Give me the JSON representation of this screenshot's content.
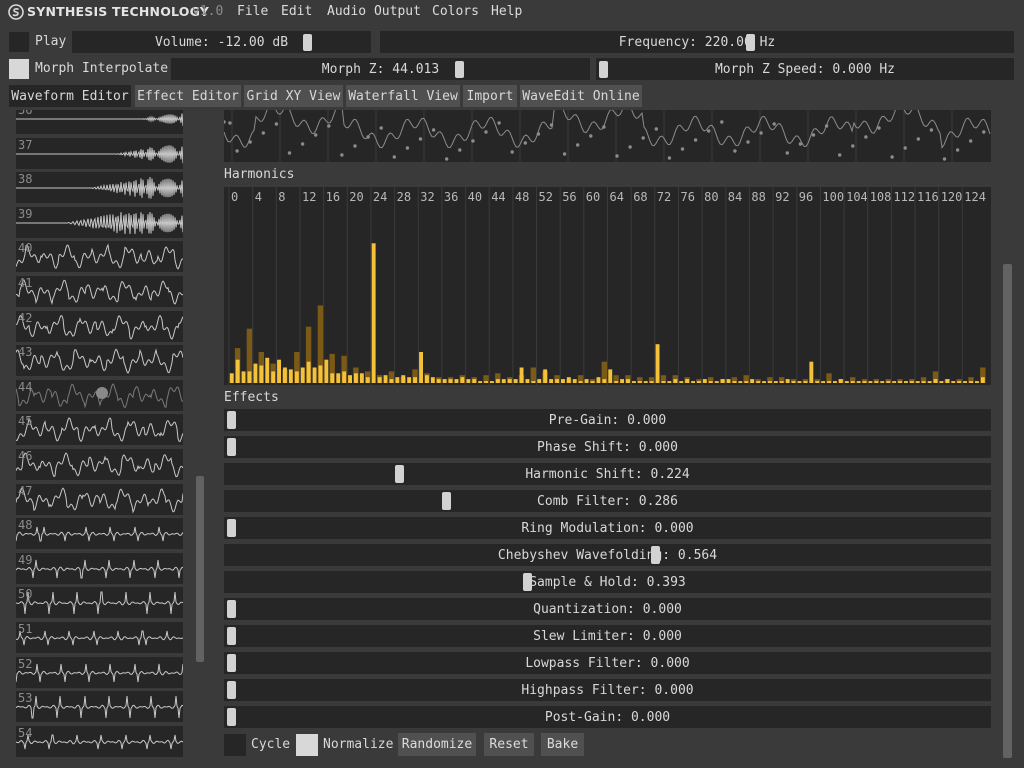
{
  "app": {
    "brand": "SYNTHESIS TECHNOLOGY",
    "version": "v1.0",
    "logo_icon": "synthesis-logo-icon"
  },
  "menu": [
    "File",
    "Edit",
    "Audio Output",
    "Colors",
    "Help"
  ],
  "controls": {
    "play_label": "Play",
    "volume_label": "Volume: -12.00 dB",
    "volume_value": "-12.00 dB",
    "frequency_label": "Frequency: 220.00 Hz",
    "frequency_value": "220.00 Hz",
    "morph_interpolate_label": "Morph Interpolate",
    "morph_z_label": "Morph Z: 44.013",
    "morph_z_value": "44.013",
    "morph_z_speed_label": "Morph Z Speed: 0.000 Hz",
    "morph_z_speed_value": "0.000 Hz"
  },
  "tabs": [
    "Waveform Editor",
    "Effect Editor",
    "Grid XY View",
    "Waterfall View",
    "Import",
    "WaveEdit Online"
  ],
  "active_tab": "Waveform Editor",
  "wave_list": [
    "36",
    "37",
    "38",
    "39",
    "40",
    "41",
    "42",
    "43",
    "44",
    "45",
    "46",
    "47",
    "48",
    "49",
    "50",
    "51",
    "52",
    "53",
    "54"
  ],
  "selected_wave": "44",
  "sections": {
    "harmonics": "Harmonics",
    "effects": "Effects"
  },
  "harmonic_labels": [
    "0",
    "4",
    "8",
    "12",
    "16",
    "20",
    "24",
    "28",
    "32",
    "36",
    "40",
    "44",
    "48",
    "52",
    "56",
    "60",
    "64",
    "68",
    "72",
    "76",
    "80",
    "84",
    "88",
    "92",
    "96",
    "100",
    "104",
    "108",
    "112",
    "116",
    "120",
    "124"
  ],
  "harmonics": {
    "max_index": 127,
    "light": [
      0.05,
      0.12,
      0.06,
      0.06,
      0.1,
      0.09,
      0.13,
      0.06,
      0.12,
      0.08,
      0.07,
      0.06,
      0.08,
      0.11,
      0.08,
      0.09,
      0.12,
      0.05,
      0.05,
      0.06,
      0.04,
      0.05,
      0.05,
      0.03,
      0.72,
      0.03,
      0.04,
      0.02,
      0.03,
      0.04,
      0.03,
      0.03,
      0.16,
      0.04,
      0.03,
      0.02,
      0.02,
      0.02,
      0.02,
      0.03,
      0.02,
      0.02,
      0.01,
      0.01,
      0.01,
      0.02,
      0.02,
      0.02,
      0.02,
      0.08,
      0.02,
      0.01,
      0.02,
      0.07,
      0.02,
      0.02,
      0.02,
      0.03,
      0.02,
      0.01,
      0.02,
      0.01,
      0.03,
      0.02,
      0.07,
      0.01,
      0.02,
      0.02,
      0.01,
      0.01,
      0.01,
      0.01,
      0.2,
      0.01,
      0.01,
      0.02,
      0.01,
      0.02,
      0.01,
      0.01,
      0.02,
      0.01,
      0.01,
      0.02,
      0.02,
      0.01,
      0.01,
      0.01,
      0.02,
      0.01,
      0.01,
      0.01,
      0.01,
      0.01,
      0.02,
      0.01,
      0.01,
      0.01,
      0.11,
      0.01,
      0.01,
      0.01,
      0.01,
      0.02,
      0.01,
      0.01,
      0.01,
      0.01,
      0.01,
      0.01,
      0.01,
      0.01,
      0.01,
      0.01,
      0.01,
      0.01,
      0.01,
      0.01,
      0.01,
      0.02,
      0.01,
      0.02,
      0.01,
      0.01,
      0.01,
      0.01,
      0.01,
      0.03
    ],
    "dark": [
      0.0,
      0.18,
      0.0,
      0.28,
      0.0,
      0.16,
      0.0,
      0.1,
      0.0,
      0.07,
      0.0,
      0.16,
      0.0,
      0.29,
      0.0,
      0.4,
      0.0,
      0.15,
      0.0,
      0.14,
      0.0,
      0.08,
      0.0,
      0.06,
      0.0,
      0.04,
      0.0,
      0.06,
      0.0,
      0.03,
      0.0,
      0.07,
      0.0,
      0.05,
      0.0,
      0.03,
      0.0,
      0.03,
      0.0,
      0.04,
      0.0,
      0.03,
      0.0,
      0.04,
      0.0,
      0.05,
      0.0,
      0.03,
      0.0,
      0.04,
      0.0,
      0.08,
      0.0,
      0.06,
      0.0,
      0.04,
      0.0,
      0.02,
      0.0,
      0.04,
      0.0,
      0.02,
      0.0,
      0.11,
      0.0,
      0.04,
      0.0,
      0.04,
      0.0,
      0.03,
      0.0,
      0.03,
      0.0,
      0.04,
      0.0,
      0.04,
      0.0,
      0.03,
      0.0,
      0.02,
      0.0,
      0.03,
      0.0,
      0.02,
      0.0,
      0.03,
      0.0,
      0.04,
      0.0,
      0.02,
      0.0,
      0.03,
      0.0,
      0.03,
      0.0,
      0.02,
      0.0,
      0.02,
      0.0,
      0.02,
      0.0,
      0.05,
      0.0,
      0.02,
      0.0,
      0.03,
      0.0,
      0.02,
      0.0,
      0.02,
      0.0,
      0.02,
      0.0,
      0.02,
      0.0,
      0.02,
      0.0,
      0.03,
      0.0,
      0.06,
      0.0,
      0.02,
      0.0,
      0.02,
      0.0,
      0.03,
      0.0,
      0.08,
      0.0,
      0.04
    ]
  },
  "effects": [
    {
      "name": "Pre-Gain",
      "label": "Pre-Gain: 0.000",
      "value": 0.0
    },
    {
      "name": "Phase Shift",
      "label": "Phase Shift: 0.000",
      "value": 0.0
    },
    {
      "name": "Harmonic Shift",
      "label": "Harmonic Shift: 0.224",
      "value": 0.224
    },
    {
      "name": "Comb Filter",
      "label": "Comb Filter: 0.286",
      "value": 0.286
    },
    {
      "name": "Ring Modulation",
      "label": "Ring Modulation: 0.000",
      "value": 0.0
    },
    {
      "name": "Chebyshev Wavefolding",
      "label": "Chebyshev Wavefolding: 0.564",
      "value": 0.564
    },
    {
      "name": "Sample & Hold",
      "label": "Sample & Hold: 0.393",
      "value": 0.393
    },
    {
      "name": "Quantization",
      "label": "Quantization: 0.000",
      "value": 0.0
    },
    {
      "name": "Slew Limiter",
      "label": "Slew Limiter: 0.000",
      "value": 0.0
    },
    {
      "name": "Lowpass Filter",
      "label": "Lowpass Filter: 0.000",
      "value": 0.0
    },
    {
      "name": "Highpass Filter",
      "label": "Highpass Filter: 0.000",
      "value": 0.0
    },
    {
      "name": "Post-Gain",
      "label": "Post-Gain: 0.000",
      "value": 0.0
    }
  ],
  "footer": {
    "cycle_label": "Cycle",
    "normalize_label": "Normalize",
    "randomize_label": "Randomize",
    "reset_label": "Reset",
    "bake_label": "Bake"
  },
  "colors": {
    "background": "#3a3a3a",
    "panel": "#262626",
    "button": "#505050",
    "harmonic_bright": "#f4c23a",
    "harmonic_dim": "#7a5a16"
  }
}
